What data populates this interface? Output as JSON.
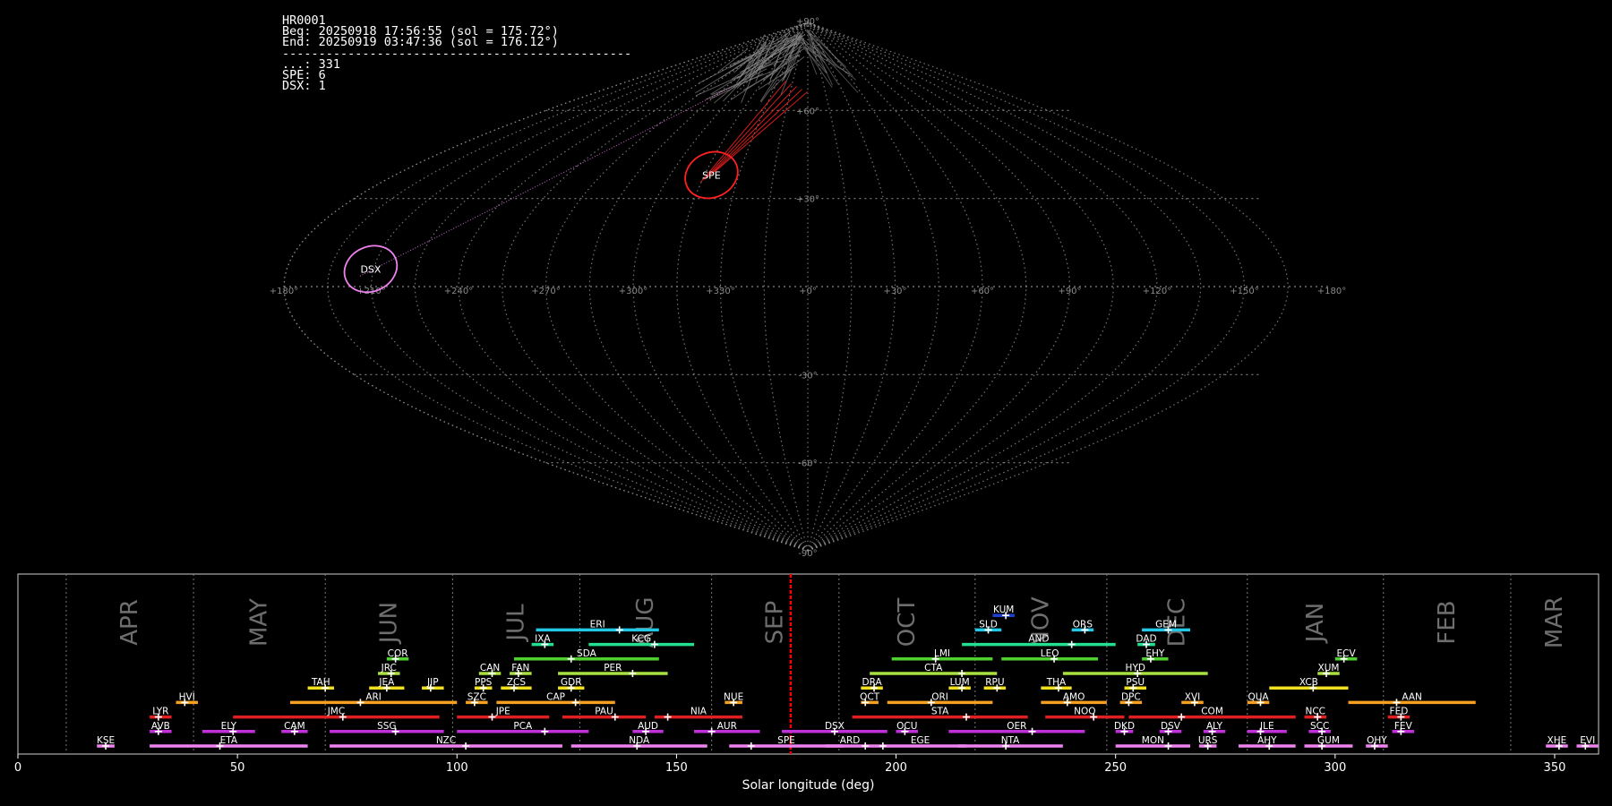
{
  "info": {
    "station": "HR0001",
    "begin": "Beg: 20250918 17:56:55 (sol = 175.72°)",
    "end": "End: 20250919 03:47:36 (sol = 176.12°)",
    "separator": "------------------------------------------------",
    "counts": [
      "...: 331",
      "SPE: 6",
      "DSX: 1"
    ]
  },
  "colors": {
    "background": "#000000",
    "grid": "#9a9a9a",
    "sporadic": "#8a8a8a",
    "spe": "#ff2020",
    "dsx": "#ee82ee",
    "current_sol": "#ff0000"
  },
  "chart_data": [
    {
      "type": "scatter",
      "projection": "sinusoidal",
      "lon_ticks": [
        "+180°",
        "+150°",
        "+120°",
        "+90°",
        "+60°",
        "+30°",
        "+0°",
        "+330°",
        "+300°",
        "+270°",
        "+240°",
        "+210°",
        "+180°"
      ],
      "lat_ticks": [
        {
          "lat": 90,
          "label": "+90°"
        },
        {
          "lat": 60,
          "label": "+60°"
        },
        {
          "lat": 30,
          "label": "+30°"
        },
        {
          "lat": -30,
          "label": "-30°"
        },
        {
          "lat": -60,
          "label": "-60°"
        },
        {
          "lat": -90,
          "label": "-90°"
        }
      ],
      "showers": [
        {
          "code": "SPE",
          "lon": 42,
          "lat": 38,
          "radius_deg": 8
        },
        {
          "code": "DSX",
          "lon": 151,
          "lat": 6,
          "radius_deg": 8
        }
      ]
    },
    {
      "type": "gantt",
      "xlabel": "Solar longitude (deg)",
      "xlim": [
        0,
        360
      ],
      "xticks": [
        0,
        50,
        100,
        150,
        200,
        250,
        300,
        350
      ],
      "current_sol": 176,
      "months": [
        {
          "name": "APR",
          "sol": 11
        },
        {
          "name": "MAY",
          "sol": 40
        },
        {
          "name": "JUN",
          "sol": 70
        },
        {
          "name": "JUL",
          "sol": 99
        },
        {
          "name": "AUG",
          "sol": 128
        },
        {
          "name": "SEP",
          "sol": 158
        },
        {
          "name": "OCT",
          "sol": 187
        },
        {
          "name": "NOV",
          "sol": 218
        },
        {
          "name": "DEC",
          "sol": 248
        },
        {
          "name": "JAN",
          "sol": 280
        },
        {
          "name": "FEB",
          "sol": 311
        },
        {
          "name": "MAR",
          "sol": 340
        }
      ],
      "showers": [
        {
          "code": "KUM",
          "start": 222,
          "end": 227,
          "peak": 225,
          "row": 9,
          "color": "#1f3fcf"
        },
        {
          "code": "ERI",
          "start": 118,
          "end": 146,
          "peak": 137,
          "row": 8,
          "color": "#22c8e6"
        },
        {
          "code": "SLD",
          "start": 218,
          "end": 224,
          "peak": 221,
          "row": 8,
          "color": "#22c8e6"
        },
        {
          "code": "ORS",
          "start": 240,
          "end": 245,
          "peak": 243,
          "row": 8,
          "color": "#22c8e6"
        },
        {
          "code": "GEM",
          "start": 256,
          "end": 267,
          "peak": 262,
          "row": 8,
          "color": "#22c8e6"
        },
        {
          "code": "IXA",
          "start": 117,
          "end": 122,
          "peak": 120,
          "row": 7,
          "color": "#22e090"
        },
        {
          "code": "KCG",
          "start": 130,
          "end": 154,
          "peak": 145,
          "row": 7,
          "color": "#22e090"
        },
        {
          "code": "AND",
          "start": 215,
          "end": 250,
          "peak": 240,
          "row": 7,
          "color": "#22e090"
        },
        {
          "code": "DAD",
          "start": 255,
          "end": 259,
          "peak": 257,
          "row": 7,
          "color": "#22e090"
        },
        {
          "code": "COR",
          "start": 84,
          "end": 89,
          "peak": 86,
          "row": 6,
          "color": "#50d030"
        },
        {
          "code": "SDA",
          "start": 113,
          "end": 146,
          "peak": 126,
          "row": 6,
          "color": "#50d030"
        },
        {
          "code": "LMI",
          "start": 199,
          "end": 222,
          "peak": 209,
          "row": 6,
          "color": "#50d030"
        },
        {
          "code": "LEO",
          "start": 224,
          "end": 246,
          "peak": 236,
          "row": 6,
          "color": "#50d030"
        },
        {
          "code": "EHY",
          "start": 256,
          "end": 262,
          "peak": 258,
          "row": 6,
          "color": "#50d030"
        },
        {
          "code": "ECV",
          "start": 300,
          "end": 305,
          "peak": 302,
          "row": 6,
          "color": "#50d030"
        },
        {
          "code": "JRC",
          "start": 82,
          "end": 87,
          "peak": 85,
          "row": 5,
          "color": "#a8e040"
        },
        {
          "code": "CAN",
          "start": 105,
          "end": 110,
          "peak": 108,
          "row": 5,
          "color": "#a8e040"
        },
        {
          "code": "FAN",
          "start": 112,
          "end": 117,
          "peak": 114,
          "row": 5,
          "color": "#a8e040"
        },
        {
          "code": "PER",
          "start": 123,
          "end": 148,
          "peak": 140,
          "row": 5,
          "color": "#a8e040"
        },
        {
          "code": "CTA",
          "start": 194,
          "end": 223,
          "peak": 215,
          "row": 5,
          "color": "#a8e040"
        },
        {
          "code": "HYD",
          "start": 238,
          "end": 271,
          "peak": 255,
          "row": 5,
          "color": "#a8e040"
        },
        {
          "code": "XUM",
          "start": 296,
          "end": 301,
          "peak": 298,
          "row": 5,
          "color": "#a8e040"
        },
        {
          "code": "TAH",
          "start": 66,
          "end": 72,
          "peak": 70,
          "row": 4,
          "color": "#f0e020"
        },
        {
          "code": "JEA",
          "start": 80,
          "end": 88,
          "peak": 84,
          "row": 4,
          "color": "#f0e020"
        },
        {
          "code": "JIP",
          "start": 92,
          "end": 97,
          "peak": 94,
          "row": 4,
          "color": "#f0e020"
        },
        {
          "code": "PPS",
          "start": 104,
          "end": 108,
          "peak": 106,
          "row": 4,
          "color": "#f0e020"
        },
        {
          "code": "ZCS",
          "start": 110,
          "end": 117,
          "peak": 113,
          "row": 4,
          "color": "#f0e020"
        },
        {
          "code": "GDR",
          "start": 123,
          "end": 129,
          "peak": 126,
          "row": 4,
          "color": "#f0e020"
        },
        {
          "code": "DRA",
          "start": 192,
          "end": 197,
          "peak": 195,
          "row": 4,
          "color": "#f0e020"
        },
        {
          "code": "LUM",
          "start": 212,
          "end": 217,
          "peak": 215,
          "row": 4,
          "color": "#f0e020"
        },
        {
          "code": "RPU",
          "start": 220,
          "end": 225,
          "peak": 223,
          "row": 4,
          "color": "#f0e020"
        },
        {
          "code": "THA",
          "start": 233,
          "end": 240,
          "peak": 237,
          "row": 4,
          "color": "#f0e020"
        },
        {
          "code": "PSU",
          "start": 252,
          "end": 257,
          "peak": 254,
          "row": 4,
          "color": "#f0e020"
        },
        {
          "code": "XCB",
          "start": 285,
          "end": 303,
          "peak": 295,
          "row": 4,
          "color": "#f0e020"
        },
        {
          "code": "HVI",
          "start": 36,
          "end": 41,
          "peak": 38,
          "row": 3,
          "color": "#f5a020"
        },
        {
          "code": "ARI",
          "start": 62,
          "end": 100,
          "peak": 78,
          "row": 3,
          "color": "#f5a020"
        },
        {
          "code": "SZC",
          "start": 102,
          "end": 107,
          "peak": 104,
          "row": 3,
          "color": "#f5a020"
        },
        {
          "code": "CAP",
          "start": 109,
          "end": 136,
          "peak": 127,
          "row": 3,
          "color": "#f5a020"
        },
        {
          "code": "NUE",
          "start": 161,
          "end": 165,
          "peak": 163,
          "row": 3,
          "color": "#f5a020"
        },
        {
          "code": "OCT",
          "start": 192,
          "end": 196,
          "peak": 193,
          "row": 3,
          "color": "#f5a020"
        },
        {
          "code": "ORI",
          "start": 198,
          "end": 222,
          "peak": 208,
          "row": 3,
          "color": "#f5a020"
        },
        {
          "code": "AMO",
          "start": 233,
          "end": 248,
          "peak": 239,
          "row": 3,
          "color": "#f5a020"
        },
        {
          "code": "DPC",
          "start": 251,
          "end": 256,
          "peak": 253,
          "row": 3,
          "color": "#f5a020"
        },
        {
          "code": "XVI",
          "start": 265,
          "end": 270,
          "peak": 268,
          "row": 3,
          "color": "#f5a020"
        },
        {
          "code": "QUA",
          "start": 280,
          "end": 285,
          "peak": 283,
          "row": 3,
          "color": "#f5a020"
        },
        {
          "code": "AAN",
          "start": 303,
          "end": 332,
          "peak": 314,
          "row": 3,
          "color": "#f5a020"
        },
        {
          "code": "LYR",
          "start": 30,
          "end": 35,
          "peak": 32,
          "row": 2,
          "color": "#e02020"
        },
        {
          "code": "JMC",
          "start": 49,
          "end": 96,
          "peak": 74,
          "row": 2,
          "color": "#e02020"
        },
        {
          "code": "JPE",
          "start": 100,
          "end": 121,
          "peak": 108,
          "row": 2,
          "color": "#e02020"
        },
        {
          "code": "PAU",
          "start": 124,
          "end": 143,
          "peak": 136,
          "row": 2,
          "color": "#e02020"
        },
        {
          "code": "NIA",
          "start": 145,
          "end": 165,
          "peak": 148,
          "row": 2,
          "color": "#e02020"
        },
        {
          "code": "STA",
          "start": 190,
          "end": 230,
          "peak": 216,
          "row": 2,
          "color": "#e02020"
        },
        {
          "code": "NOO",
          "start": 234,
          "end": 252,
          "peak": 245,
          "row": 2,
          "color": "#e02020"
        },
        {
          "code": "COM",
          "start": 253,
          "end": 291,
          "peak": 265,
          "row": 2,
          "color": "#e02020"
        },
        {
          "code": "NCC",
          "start": 293,
          "end": 298,
          "peak": 296,
          "row": 2,
          "color": "#e02020"
        },
        {
          "code": "FED",
          "start": 312,
          "end": 317,
          "peak": 315,
          "row": 2,
          "color": "#e02020"
        },
        {
          "code": "AVB",
          "start": 30,
          "end": 35,
          "peak": 32,
          "row": 1,
          "color": "#c030d8"
        },
        {
          "code": "ELY",
          "start": 42,
          "end": 54,
          "peak": 49,
          "row": 1,
          "color": "#c030d8"
        },
        {
          "code": "CAM",
          "start": 60,
          "end": 66,
          "peak": 63,
          "row": 1,
          "color": "#c030d8"
        },
        {
          "code": "SSG",
          "start": 71,
          "end": 97,
          "peak": 86,
          "row": 1,
          "color": "#c030d8"
        },
        {
          "code": "PCA",
          "start": 100,
          "end": 130,
          "peak": 120,
          "row": 1,
          "color": "#c030d8"
        },
        {
          "code": "AUD",
          "start": 140,
          "end": 147,
          "peak": 143,
          "row": 1,
          "color": "#c030d8"
        },
        {
          "code": "AUR",
          "start": 154,
          "end": 169,
          "peak": 158,
          "row": 1,
          "color": "#c030d8"
        },
        {
          "code": "DSX",
          "start": 174,
          "end": 198,
          "peak": 186,
          "row": 1,
          "color": "#c030d8"
        },
        {
          "code": "OCU",
          "start": 200,
          "end": 205,
          "peak": 202,
          "row": 1,
          "color": "#c030d8"
        },
        {
          "code": "OER",
          "start": 212,
          "end": 243,
          "peak": 231,
          "row": 1,
          "color": "#c030d8"
        },
        {
          "code": "DKD",
          "start": 250,
          "end": 254,
          "peak": 252,
          "row": 1,
          "color": "#c030d8"
        },
        {
          "code": "DSV",
          "start": 260,
          "end": 265,
          "peak": 262,
          "row": 1,
          "color": "#c030d8"
        },
        {
          "code": "ALY",
          "start": 270,
          "end": 275,
          "peak": 272,
          "row": 1,
          "color": "#c030d8"
        },
        {
          "code": "JLE",
          "start": 280,
          "end": 289,
          "peak": 283,
          "row": 1,
          "color": "#c030d8"
        },
        {
          "code": "SCC",
          "start": 294,
          "end": 299,
          "peak": 297,
          "row": 1,
          "color": "#c030d8"
        },
        {
          "code": "FEV",
          "start": 313,
          "end": 318,
          "peak": 315,
          "row": 1,
          "color": "#c030d8"
        },
        {
          "code": "KSE",
          "start": 18,
          "end": 22,
          "peak": 20,
          "row": 0,
          "color": "#ee82ee"
        },
        {
          "code": "ETA",
          "start": 30,
          "end": 66,
          "peak": 46,
          "row": 0,
          "color": "#ee82ee"
        },
        {
          "code": "NZC",
          "start": 71,
          "end": 124,
          "peak": 102,
          "row": 0,
          "color": "#ee82ee"
        },
        {
          "code": "NDA",
          "start": 126,
          "end": 157,
          "peak": 141,
          "row": 0,
          "color": "#ee82ee"
        },
        {
          "code": "SPE",
          "start": 162,
          "end": 188,
          "peak": 167,
          "row": 0,
          "color": "#ee82ee"
        },
        {
          "code": "ARD",
          "start": 184,
          "end": 195,
          "peak": 193,
          "row": 0,
          "color": "#ee82ee"
        },
        {
          "code": "EGE",
          "start": 195,
          "end": 216,
          "peak": 197,
          "row": 0,
          "color": "#ee82ee"
        },
        {
          "code": "NTA",
          "start": 214,
          "end": 238,
          "peak": 225,
          "row": 0,
          "color": "#ee82ee"
        },
        {
          "code": "MON",
          "start": 250,
          "end": 267,
          "peak": 262,
          "row": 0,
          "color": "#ee82ee"
        },
        {
          "code": "URS",
          "start": 269,
          "end": 273,
          "peak": 271,
          "row": 0,
          "color": "#ee82ee"
        },
        {
          "code": "AHY",
          "start": 278,
          "end": 291,
          "peak": 285,
          "row": 0,
          "color": "#ee82ee"
        },
        {
          "code": "GUM",
          "start": 293,
          "end": 304,
          "peak": 297,
          "row": 0,
          "color": "#ee82ee"
        },
        {
          "code": "OHY",
          "start": 307,
          "end": 312,
          "peak": 309,
          "row": 0,
          "color": "#ee82ee"
        },
        {
          "code": "XHE",
          "start": 348,
          "end": 353,
          "peak": 351,
          "row": 0,
          "color": "#ee82ee"
        },
        {
          "code": "EVI",
          "start": 355,
          "end": 360,
          "peak": 357,
          "row": 0,
          "color": "#ee82ee"
        }
      ]
    }
  ]
}
